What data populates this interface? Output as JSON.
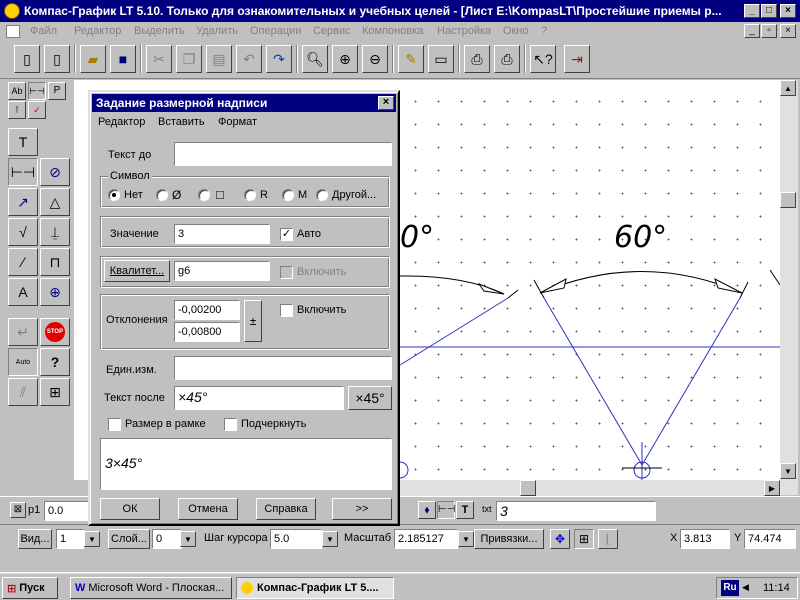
{
  "window": {
    "title": "Компас-График LT 5.10. Только для ознакомительных и учебных целей - [Лист E:\\KompasLT\\Простейшие приемы р...",
    "minimize": "_",
    "maximize": "□",
    "close": "×"
  },
  "menu": [
    "Файл",
    "Редактор",
    "Выделить",
    "Удалить",
    "Операции",
    "Сервис",
    "Компоновка",
    "Настройка",
    "Окно",
    "?"
  ],
  "left_panel": {
    "tabs": [
      "Ab",
      "⊢⊣",
      "P"
    ]
  },
  "drawing": {
    "angle_label_1": "60°",
    "angle_label_2": "0°"
  },
  "dialog": {
    "title": "Задание размерной надписи",
    "menu": [
      "Редактор",
      "Вставить",
      "Формат"
    ],
    "text_before_label": "Текст до",
    "text_before_value": "",
    "symbol_group_label": "Символ",
    "symbols": {
      "none": "Нет",
      "diameter": "Ø",
      "square": "□",
      "radius": "R",
      "metric": "M",
      "other": "Другой..."
    },
    "value_label": "Значение",
    "value": "3",
    "auto_label": "Авто",
    "auto_checked": true,
    "quality_button": "Квалитет...",
    "quality_value": "g6",
    "quality_enable_label": "Включить",
    "deviations_label": "Отклонения",
    "deviation_upper": "-0,00200",
    "deviation_lower": "-0,00800",
    "plusminus_button": "±",
    "deviations_enable_label": "Включить",
    "units_label": "Един.изм.",
    "units_value": "",
    "text_after_label": "Текст после",
    "text_after_value": "×45°",
    "text_after_button": "×45°",
    "frame_label": "Размер в рамке",
    "underline_label": "Подчеркнуть",
    "preview": "3×45°",
    "ok_button": "ОК",
    "cancel_button": "Отмена",
    "help_button": "Справка",
    "more_button": ">>"
  },
  "param_bar": {
    "p1_label": "p1",
    "p1_value": "0.0",
    "text_field_label": "txt",
    "text_field_value": "3"
  },
  "status": {
    "view_button": "Вид...",
    "view_value": "1",
    "layer_button": "Слой...",
    "layer_value": "0",
    "cursor_step_label": "Шаг курсора",
    "cursor_step_value": "5.0",
    "scale_label": "Масштаб",
    "scale_value": "2.185127",
    "snaps_button": "Привязки...",
    "x_label": "X",
    "x_value": "3.813",
    "y_label": "Y",
    "y_value": "74.474"
  },
  "taskbar": {
    "start": "Пуск",
    "tasks": [
      "Microsoft Word - Плоская...",
      "Компас-График LT 5...."
    ],
    "lang": "Ru",
    "time": "11:14"
  }
}
